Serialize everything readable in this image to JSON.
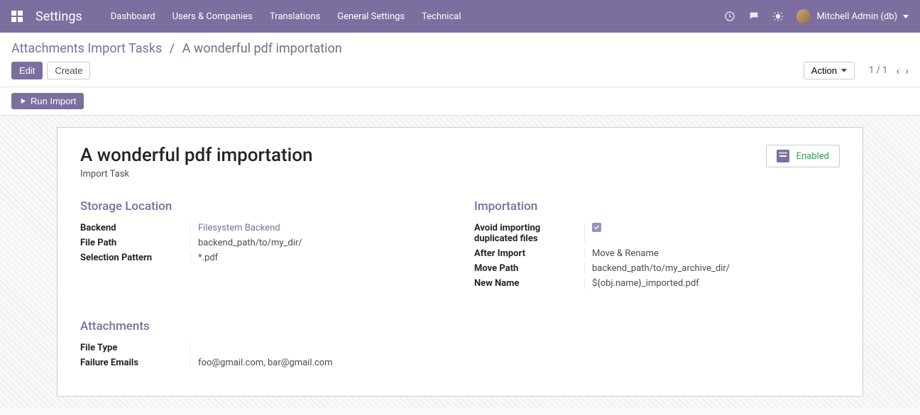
{
  "topbar": {
    "brand": "Settings",
    "menu": [
      "Dashboard",
      "Users & Companies",
      "Translations",
      "General Settings",
      "Technical"
    ],
    "user": "Mitchell Admin (db)"
  },
  "breadcrumb": {
    "parent": "Attachments Import Tasks",
    "current": "A wonderful pdf importation"
  },
  "buttons": {
    "edit": "Edit",
    "create": "Create",
    "action": "Action",
    "run_import": "Run Import"
  },
  "pager": {
    "text": "1 / 1"
  },
  "record": {
    "title": "A wonderful pdf importation",
    "subtitle": "Import Task",
    "status": "Enabled"
  },
  "sections": {
    "storage": {
      "title": "Storage Location",
      "backend_label": "Backend",
      "backend_value": "Filesystem Backend",
      "filepath_label": "File Path",
      "filepath_value": "backend_path/to/my_dir/",
      "pattern_label": "Selection Pattern",
      "pattern_value": "*.pdf"
    },
    "importation": {
      "title": "Importation",
      "avoid_label": "Avoid importing duplicated files",
      "avoid_value": true,
      "after_label": "After Import",
      "after_value": "Move & Rename",
      "movepath_label": "Move Path",
      "movepath_value": "backend_path/to/my_archive_dir/",
      "newname_label": "New Name",
      "newname_value": "${obj.name}_imported.pdf"
    },
    "attachments": {
      "title": "Attachments",
      "filetype_label": "File Type",
      "filetype_value": "",
      "failure_label": "Failure Emails",
      "failure_value": "foo@gmail.com, bar@gmail.com"
    }
  }
}
